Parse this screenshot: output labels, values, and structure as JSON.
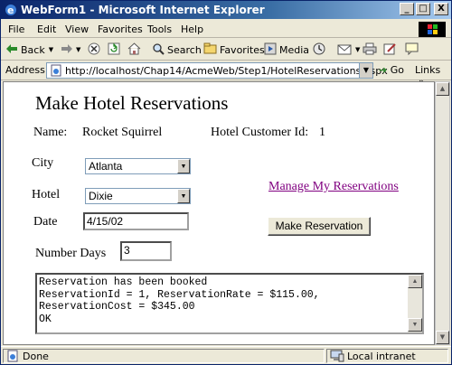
{
  "window": {
    "title": "WebForm1 - Microsoft Internet Explorer"
  },
  "window_controls": {
    "minimize": "_",
    "maximize": "□",
    "close": "X"
  },
  "menu": [
    "File",
    "Edit",
    "View",
    "Favorites",
    "Tools",
    "Help"
  ],
  "toolbar": {
    "back": "Back",
    "search": "Search",
    "favorites": "Favorites",
    "media": "Media"
  },
  "address": {
    "label": "Address",
    "url": "http://localhost/Chap14/AcmeWeb/Step1/HotelReservations.aspx",
    "go": "Go",
    "links": "Links",
    "more": "»"
  },
  "page": {
    "title": "Make Hotel Reservations",
    "name_label": "Name:",
    "name_value": "Rocket Squirrel",
    "customer_id_label": "Hotel Customer Id:",
    "customer_id_value": "1",
    "city_label": "City",
    "city_value": "Atlanta",
    "hotel_label": "Hotel",
    "hotel_value": "Dixie",
    "date_label": "Date",
    "date_value": "4/15/02",
    "days_label": "Number Days",
    "days_value": "3",
    "manage_link": "Manage My Reservations",
    "make_button": "Make Reservation",
    "result_text": "Reservation has been booked\nReservationId = 1, ReservationRate = $115.00,\nReservationCost = $345.00\nOK"
  },
  "status": {
    "left": "Done",
    "zone": "Local intranet"
  },
  "colors": {
    "titlebar": "#0a246a",
    "link_visited": "#800080",
    "chrome": "#ece9d8"
  }
}
